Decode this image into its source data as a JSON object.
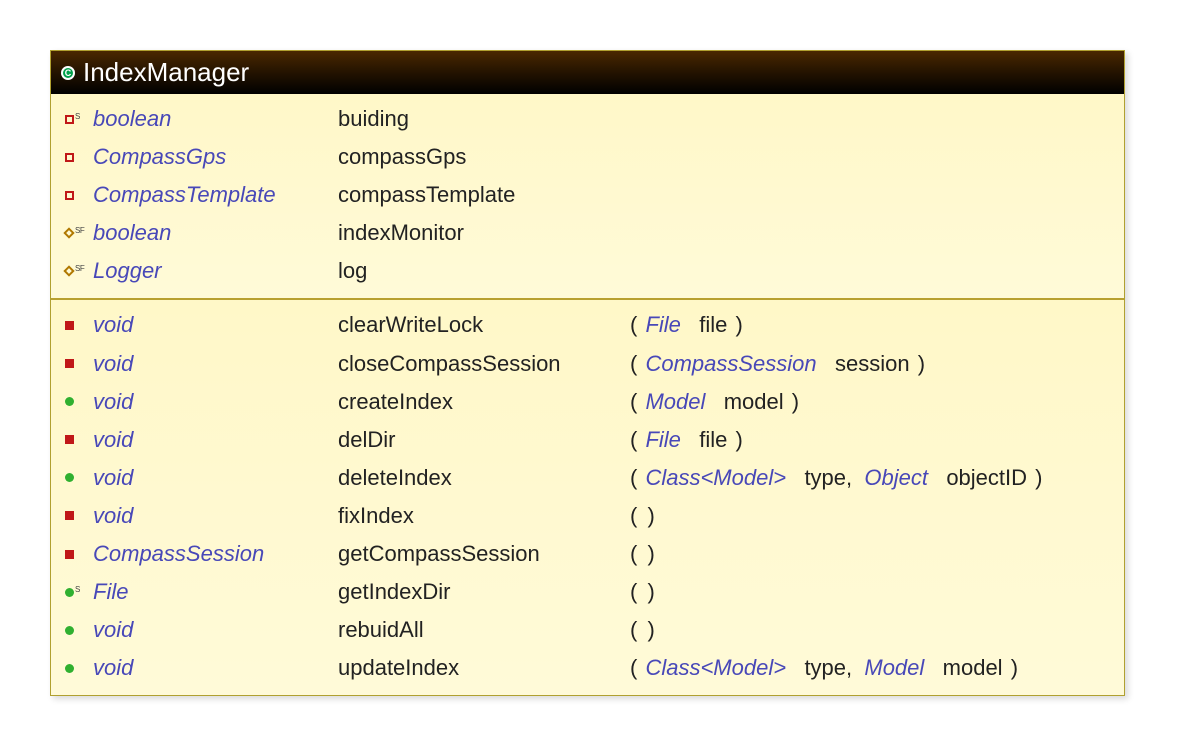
{
  "class_name": "IndexManager",
  "class_icon_letter": "C",
  "fields": [
    {
      "vis": "private",
      "badge": "S",
      "type": "boolean",
      "name": "buiding"
    },
    {
      "vis": "private",
      "badge": "",
      "type": "CompassGps",
      "name": "compassGps"
    },
    {
      "vis": "private",
      "badge": "",
      "type": "CompassTemplate",
      "name": "compassTemplate"
    },
    {
      "vis": "default",
      "badge": "SF",
      "type": "boolean",
      "name": "indexMonitor"
    },
    {
      "vis": "default",
      "badge": "SF",
      "type": "Logger",
      "name": "log"
    }
  ],
  "methods": [
    {
      "vis": "protected",
      "badge": "",
      "ret": "void",
      "name": "clearWriteLock",
      "params": [
        {
          "type": "File",
          "name": "file"
        }
      ]
    },
    {
      "vis": "protected",
      "badge": "",
      "ret": "void",
      "name": "closeCompassSession",
      "params": [
        {
          "type": "CompassSession",
          "name": "session"
        }
      ]
    },
    {
      "vis": "public",
      "badge": "",
      "ret": "void",
      "name": "createIndex",
      "params": [
        {
          "type": "Model",
          "name": "model"
        }
      ]
    },
    {
      "vis": "protected",
      "badge": "",
      "ret": "void",
      "name": "delDir",
      "params": [
        {
          "type": "File",
          "name": "file"
        }
      ]
    },
    {
      "vis": "public",
      "badge": "",
      "ret": "void",
      "name": "deleteIndex",
      "params": [
        {
          "type": "Class<Model>",
          "name": "type"
        },
        {
          "type": "Object",
          "name": "objectID"
        }
      ]
    },
    {
      "vis": "protected",
      "badge": "",
      "ret": "void",
      "name": "fixIndex",
      "params": []
    },
    {
      "vis": "protected",
      "badge": "",
      "ret": "CompassSession",
      "name": "getCompassSession",
      "params": []
    },
    {
      "vis": "public",
      "badge": "S",
      "ret": "File",
      "name": "getIndexDir",
      "params": []
    },
    {
      "vis": "public",
      "badge": "",
      "ret": "void",
      "name": "rebuidAll",
      "params": []
    },
    {
      "vis": "public",
      "badge": "",
      "ret": "void",
      "name": "updateIndex",
      "params": [
        {
          "type": "Class<Model>",
          "name": "type"
        },
        {
          "type": "Model",
          "name": "model"
        }
      ]
    }
  ]
}
